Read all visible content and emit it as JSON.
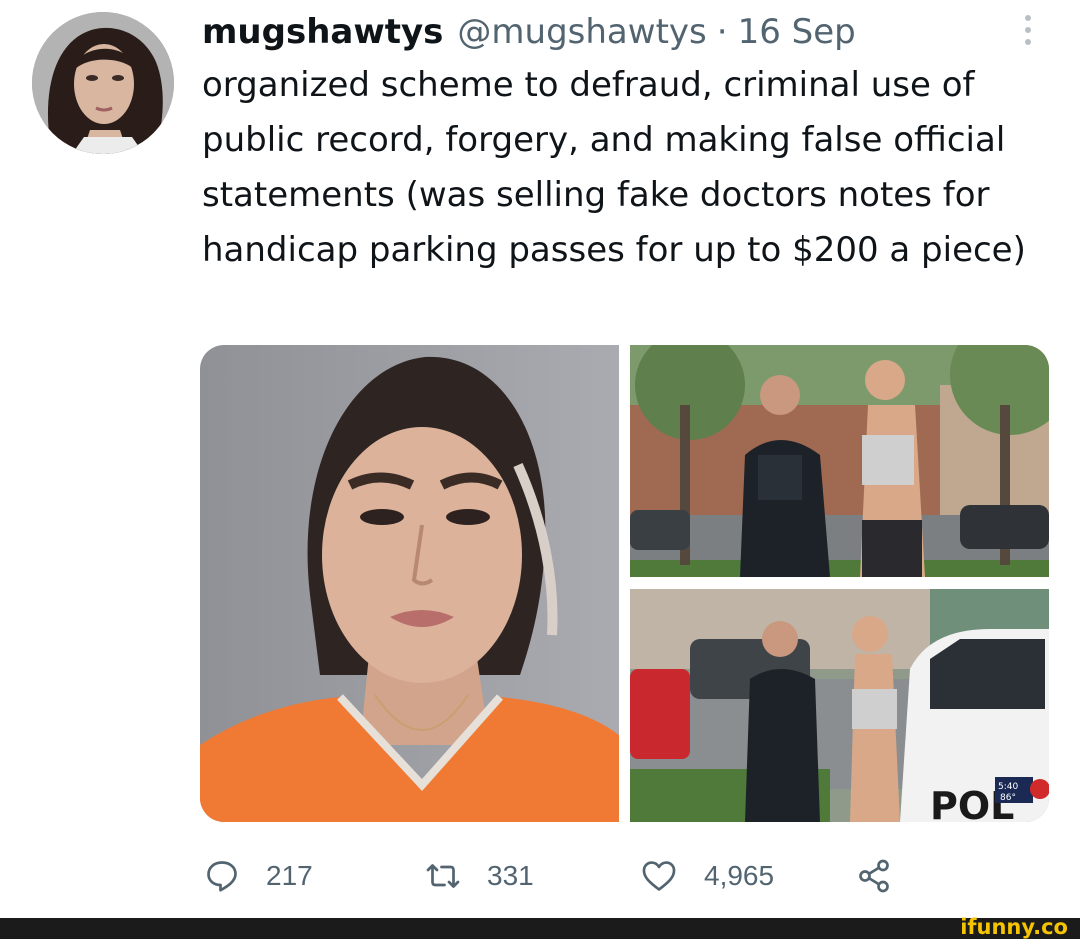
{
  "tweet": {
    "display_name": "mugshawtys",
    "handle": "@mugshawtys",
    "separator": "·",
    "date": "16 Sep",
    "text": "organized scheme to defraud, criminal use of public record, forgery, and making false official statements (was selling fake doctors notes for handicap parking passes for up to $200 a piece)"
  },
  "media": {
    "main": {
      "description": "mugshot-photo"
    },
    "top_right": {
      "description": "arrest-photo-police-officer"
    },
    "bottom_right": {
      "badge_time": "5:40",
      "badge_temp": "86°"
    }
  },
  "actions": {
    "reply_count": "217",
    "retweet_count": "331",
    "like_count": "4,965"
  },
  "icons": {
    "reply": "reply-icon",
    "retweet": "retweet-icon",
    "like": "heart-icon",
    "share": "share-icon",
    "more": "more-vertical-icon"
  },
  "colors": {
    "text_primary": "#0f1419",
    "text_secondary": "#536471",
    "jumpsuit_orange": "#f07a34",
    "watermark_yellow": "#f5c400"
  },
  "footer": {
    "watermark": "ifunny.co"
  }
}
